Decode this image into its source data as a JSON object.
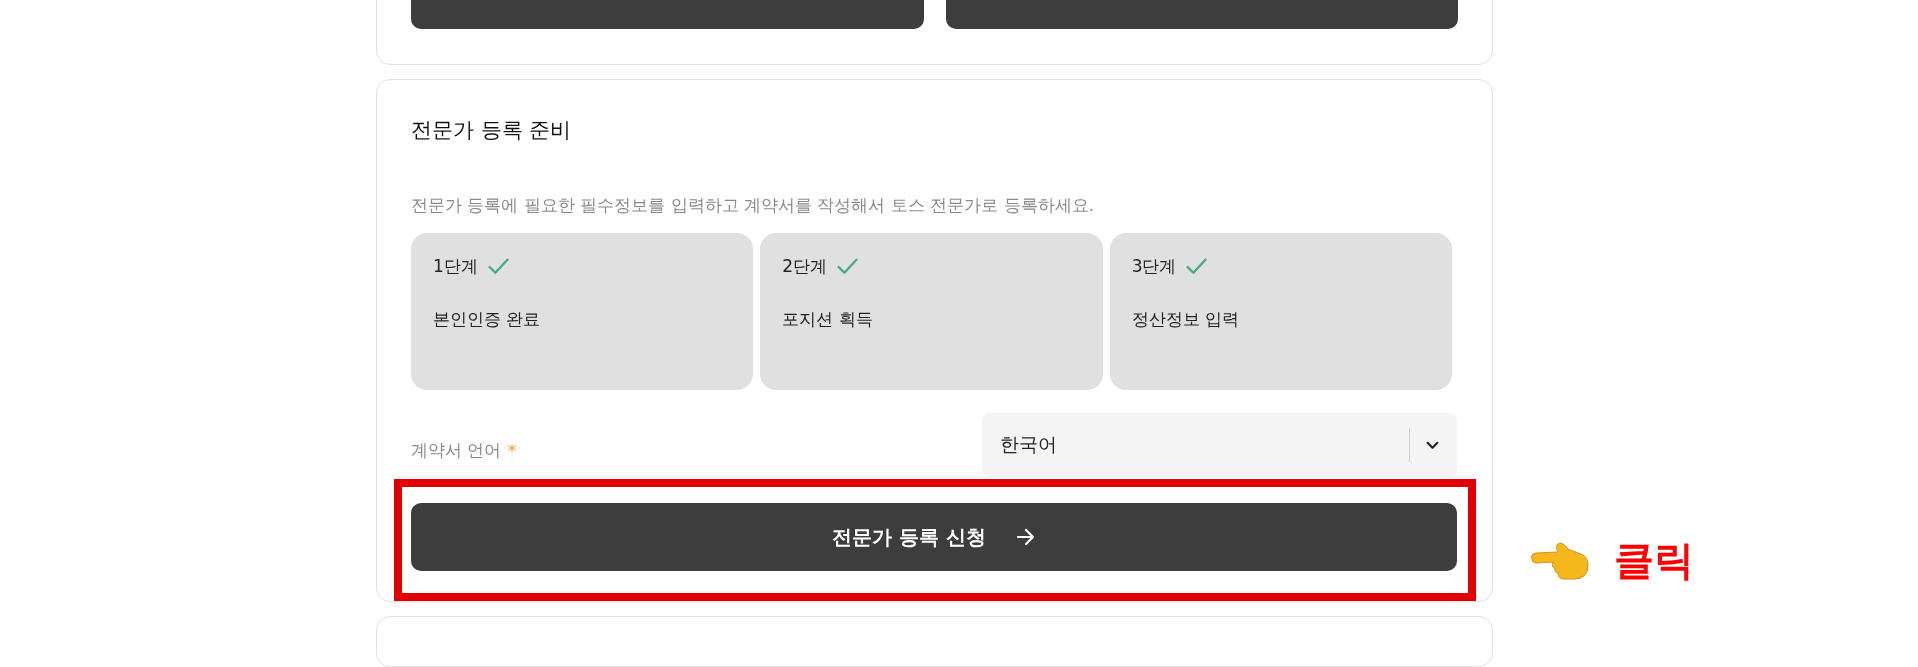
{
  "top_card": {
    "buttons": [
      {
        "kind": "dark"
      },
      {
        "kind": "dark"
      }
    ]
  },
  "registration": {
    "title": "전문가 등록 준비",
    "description": "전문가 등록에 필요한 필수정보를 입력하고 계약서를 작성해서 토스 전문가로 등록하세요.",
    "steps": [
      {
        "label": "1단계",
        "completed": true,
        "name": "본인인증 완료"
      },
      {
        "label": "2단계",
        "completed": true,
        "name": "포지션 획득"
      },
      {
        "label": "3단계",
        "completed": true,
        "name": "정산정보 입력"
      }
    ],
    "language": {
      "label": "계약서 언어",
      "required_mark": "*",
      "value": "한국어"
    },
    "submit": {
      "label": "전문가 등록 신청",
      "highlighted": true
    }
  },
  "annotation": {
    "text": "클릭"
  }
}
